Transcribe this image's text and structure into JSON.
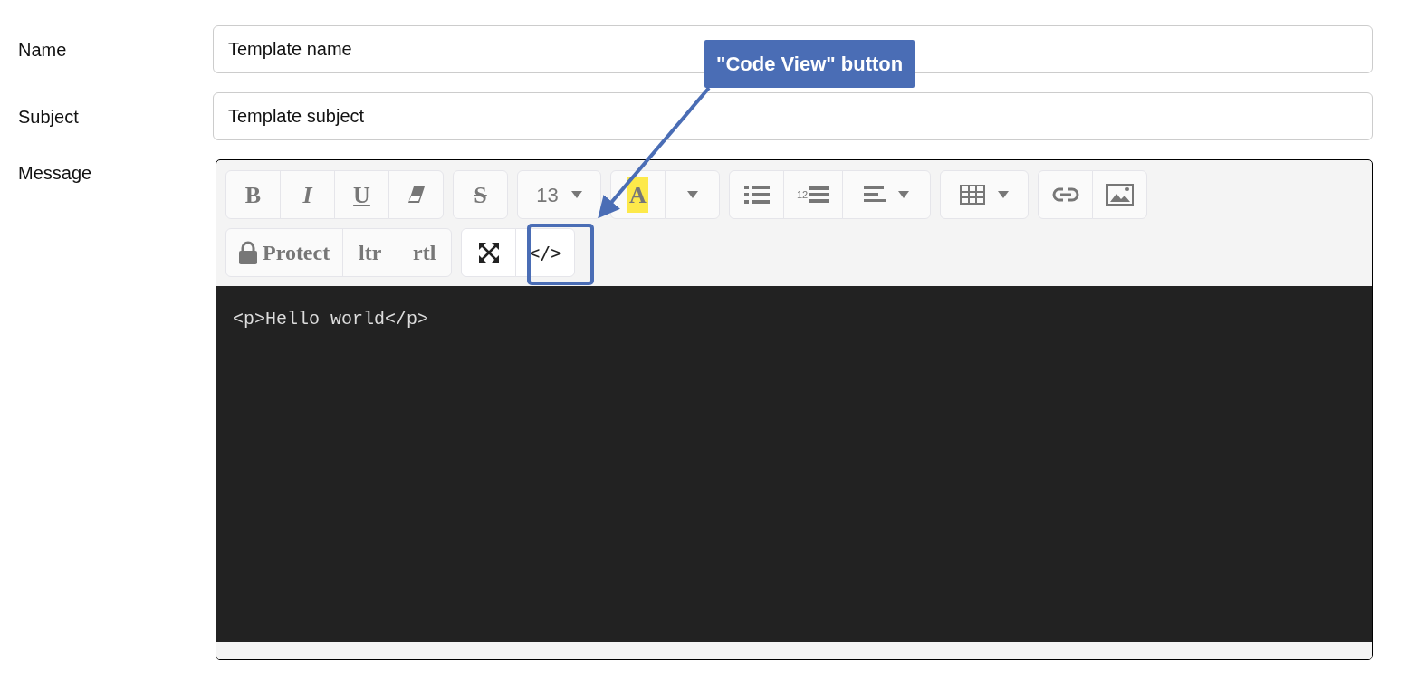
{
  "fields": [
    {
      "label": "Name",
      "value": "Template name"
    },
    {
      "label": "Subject",
      "value": "Template subject"
    }
  ],
  "message": {
    "label": "Message",
    "toolbar": [
      [
        [
          {
            "kind": "bold",
            "label": "B",
            "disabled": true
          },
          {
            "kind": "italic",
            "label": "I",
            "disabled": true
          },
          {
            "kind": "underline",
            "label": "U",
            "disabled": true
          },
          {
            "kind": "eraser",
            "disabled": true
          }
        ],
        [
          {
            "kind": "strikethrough",
            "label": "S",
            "disabled": true
          }
        ],
        [
          {
            "kind": "font-size",
            "label": "13",
            "disabled": true
          }
        ],
        [
          {
            "kind": "color",
            "label": "A",
            "disabled": true
          },
          {
            "kind": "caret",
            "disabled": true
          }
        ],
        [
          {
            "kind": "bullet-list",
            "disabled": true
          },
          {
            "kind": "numbered-list",
            "label": "12",
            "disabled": true
          },
          {
            "kind": "align",
            "disabled": true
          }
        ],
        [
          {
            "kind": "table",
            "disabled": true
          }
        ],
        [
          {
            "kind": "link",
            "disabled": true
          },
          {
            "kind": "picture",
            "disabled": true
          }
        ]
      ],
      [
        [
          {
            "kind": "protect",
            "label": "Protect",
            "disabled": true
          },
          {
            "kind": "text",
            "label": "ltr",
            "disabled": true
          },
          {
            "kind": "text",
            "label": "rtl",
            "disabled": true
          }
        ],
        [
          {
            "kind": "fullscreen",
            "disabled": false
          },
          {
            "kind": "code-view",
            "label": "</>",
            "disabled": false
          }
        ]
      ]
    ],
    "code": "<p>Hello world</p>"
  },
  "callout": {
    "text": "\"Code View\" button"
  }
}
